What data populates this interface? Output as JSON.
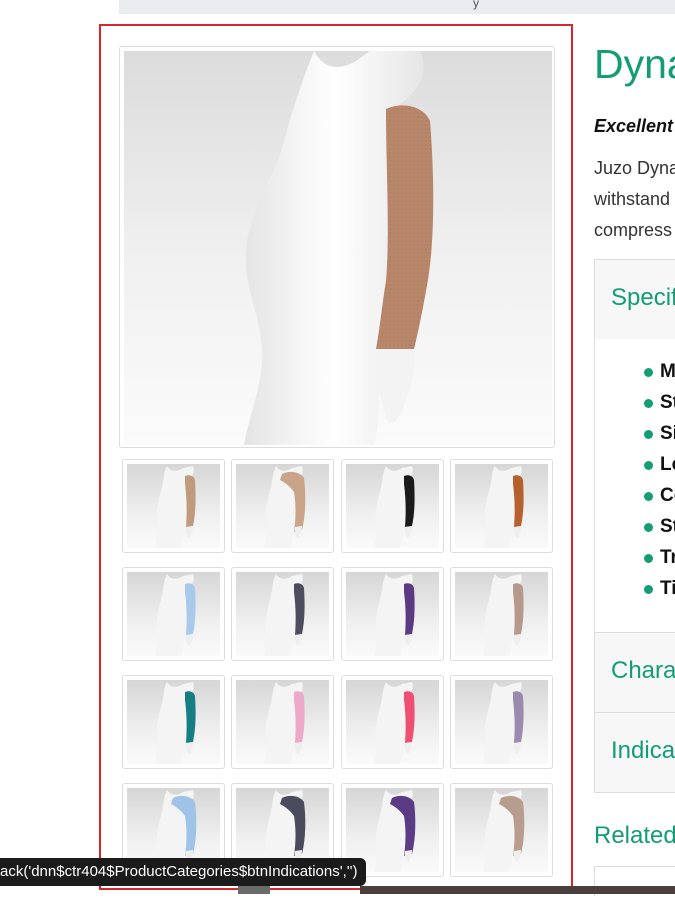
{
  "topbar": {
    "text": "y"
  },
  "product": {
    "title": "Dyna",
    "tagline": "Excellent",
    "description_lines": [
      "Juzo Dyna",
      "withstand",
      "compress"
    ]
  },
  "gallery": {
    "main_sleeve_color": "#b8876a",
    "thumbnails": [
      {
        "color": "#c09a7d",
        "style": "sleeve"
      },
      {
        "color": "#c9a488",
        "style": "shoulder"
      },
      {
        "color": "#1b1b1b",
        "style": "sleeve"
      },
      {
        "color": "#b5602e",
        "style": "sleeve"
      },
      {
        "color": "#a9c9ea",
        "style": "sleeve"
      },
      {
        "color": "#4d4d5f",
        "style": "sleeve"
      },
      {
        "color": "#5a3b83",
        "style": "sleeve"
      },
      {
        "color": "#b59a8c",
        "style": "sleeve"
      },
      {
        "color": "#157e85",
        "style": "sleeve"
      },
      {
        "color": "#ecaac8",
        "style": "sleeve"
      },
      {
        "color": "#ee4f72",
        "style": "sleeve"
      },
      {
        "color": "#9a8aae",
        "style": "sleeve"
      },
      {
        "color": "#9ec3e6",
        "style": "shoulder"
      },
      {
        "color": "#4a4b5c",
        "style": "shoulder"
      },
      {
        "color": "#5b3a86",
        "style": "shoulder"
      },
      {
        "color": "#b89c8e",
        "style": "shoulder"
      }
    ]
  },
  "accordion": {
    "specifications": "Specif",
    "characteristics": "Charac",
    "indications": "Indicat"
  },
  "spec_items": [
    "M",
    "St",
    "Si",
    "Le",
    "Co",
    "St",
    "Tr",
    "Ti"
  ],
  "related": {
    "title": "Related"
  },
  "status_bar": {
    "text": "ack('dnn$ctr404$ProductCategories$btnIndications','')"
  },
  "colors": {
    "accent": "#129d74",
    "highlight_border": "#d9262c"
  }
}
